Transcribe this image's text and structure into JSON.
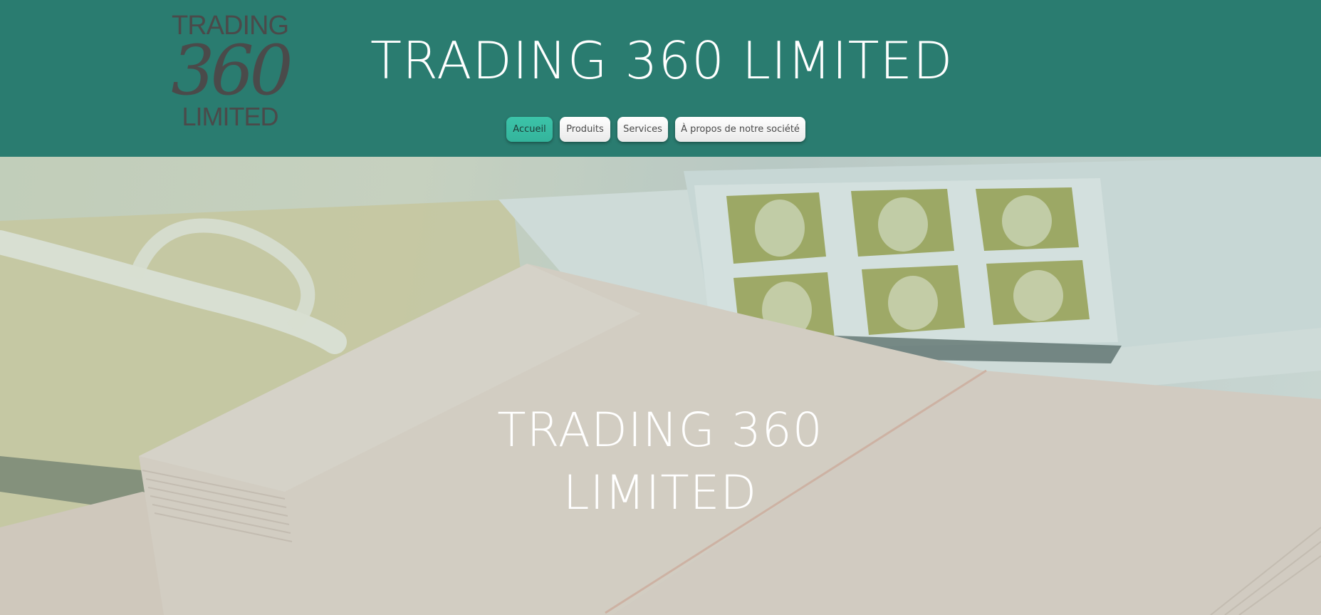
{
  "header": {
    "logo": {
      "line1": "TRADING",
      "line2": "360",
      "line3": "LIMITED"
    },
    "title": "TRADING 360 LIMITED"
  },
  "nav": {
    "items": [
      {
        "label": "Accueil",
        "active": true
      },
      {
        "label": "Produits",
        "active": false
      },
      {
        "label": "Services",
        "active": false
      },
      {
        "label": "À propos de notre société",
        "active": false
      }
    ]
  },
  "hero": {
    "title_line1": "TRADING 360",
    "title_line2": "LIMITED"
  },
  "colors": {
    "header_bg": "#2a7c70",
    "nav_active": "#3cc4a9",
    "logo_text": "#4a4a4a",
    "title_text": "#ffffff"
  }
}
